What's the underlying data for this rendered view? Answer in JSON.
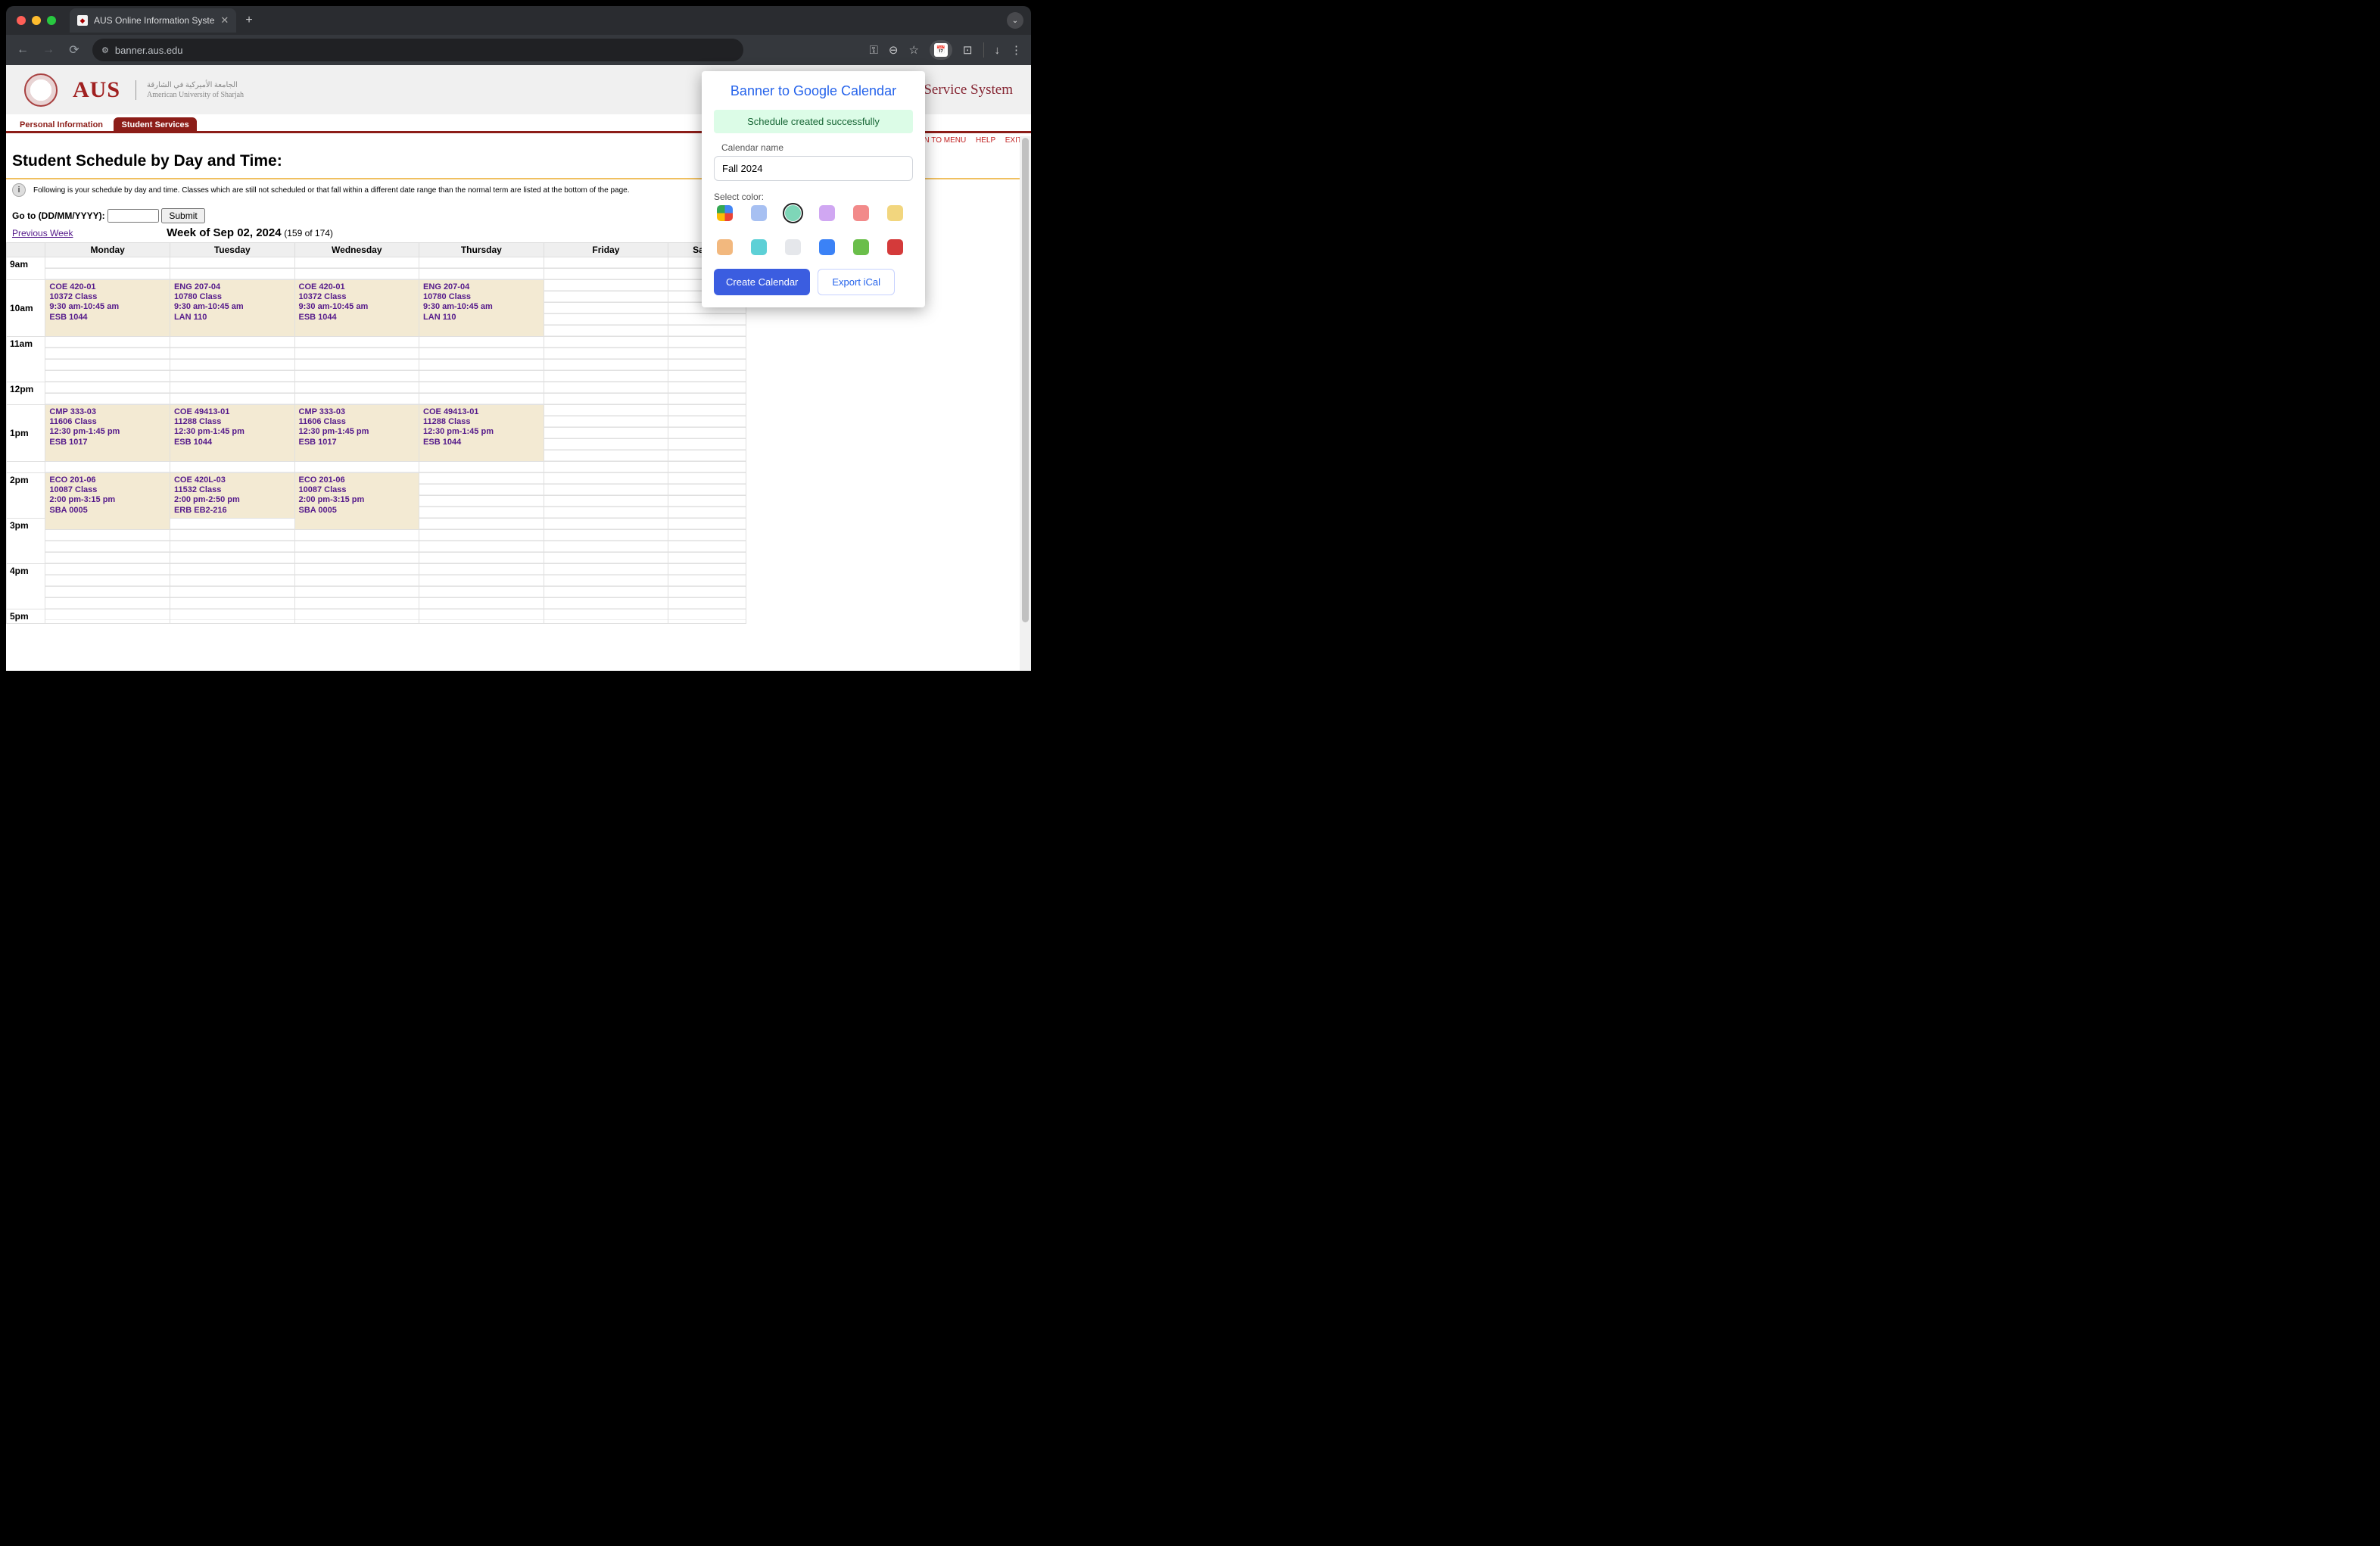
{
  "browser": {
    "tab_title": "AUS Online Information Syste",
    "url": "banner.aus.edu"
  },
  "header": {
    "logo_text": "AUS",
    "logo_arabic": "الجامعة الأميركية في الشارقة",
    "logo_sub": "American University of Sharjah",
    "service_suffix": "f-Service System"
  },
  "nav": {
    "tab1": "Personal Information",
    "tab2": "Student Services",
    "return": "RETURN TO MENU",
    "help": "HELP",
    "exit": "EXIT"
  },
  "page": {
    "title": "Student Schedule by Day and Time:",
    "help_text": "Following is your schedule by day and time. Classes which are still not scheduled or that fall within a different date range than the normal term are listed at the bottom of the page.",
    "goto_label": "Go to (DD/MM/YYYY):",
    "submit_label": "Submit",
    "prev_week": "Previous Week",
    "week_title": "Week of Sep 02, 2024",
    "week_sub": "(159 of 174)"
  },
  "days": [
    "Monday",
    "Tuesday",
    "Wednesday",
    "Thursday",
    "Friday",
    "Saturd"
  ],
  "times": [
    "9am",
    "10am",
    "11am",
    "12pm",
    "1pm",
    "2pm",
    "3pm",
    "4pm",
    "5pm"
  ],
  "events": {
    "mon_930": {
      "course": "COE 420-01",
      "crn": "10372 Class",
      "time": "9:30 am-10:45 am",
      "room": "ESB 1044"
    },
    "tue_930": {
      "course": "ENG 207-04",
      "crn": "10780 Class",
      "time": "9:30 am-10:45 am",
      "room": "LAN 110"
    },
    "wed_930": {
      "course": "COE 420-01",
      "crn": "10372 Class",
      "time": "9:30 am-10:45 am",
      "room": "ESB 1044"
    },
    "thu_930": {
      "course": "ENG 207-04",
      "crn": "10780 Class",
      "time": "9:30 am-10:45 am",
      "room": "LAN 110"
    },
    "mon_1230": {
      "course": "CMP 333-03",
      "crn": "11606 Class",
      "time": "12:30 pm-1:45 pm",
      "room": "ESB 1017"
    },
    "tue_1230": {
      "course": "COE 49413-01",
      "crn": "11288 Class",
      "time": "12:30 pm-1:45 pm",
      "room": "ESB 1044"
    },
    "wed_1230": {
      "course": "CMP 333-03",
      "crn": "11606 Class",
      "time": "12:30 pm-1:45 pm",
      "room": "ESB 1017"
    },
    "thu_1230": {
      "course": "COE 49413-01",
      "crn": "11288 Class",
      "time": "12:30 pm-1:45 pm",
      "room": "ESB 1044"
    },
    "mon_1400": {
      "course": "ECO 201-06",
      "crn": "10087 Class",
      "time": "2:00 pm-3:15 pm",
      "room": "SBA 0005"
    },
    "tue_1400": {
      "course": "COE 420L-03",
      "crn": "11532 Class",
      "time": "2:00 pm-2:50 pm",
      "room": "ERB EB2-216"
    },
    "wed_1400": {
      "course": "ECO 201-06",
      "crn": "10087 Class",
      "time": "2:00 pm-3:15 pm",
      "room": "SBA 0005"
    }
  },
  "extension": {
    "title": "Banner to Google Calendar",
    "success": "Schedule created successfully",
    "cal_label": "Calendar name",
    "cal_value": "Fall 2024",
    "color_label": "Select color:",
    "colors": [
      {
        "hex": "multi",
        "selected": false
      },
      {
        "hex": "#a7c0f2",
        "selected": false
      },
      {
        "hex": "#7ed6b8",
        "selected": true
      },
      {
        "hex": "#d0a7f2",
        "selected": false
      },
      {
        "hex": "#f28a8a",
        "selected": false
      },
      {
        "hex": "#f2d67e",
        "selected": false
      },
      {
        "hex": "#f2b87e",
        "selected": false
      },
      {
        "hex": "#5dd0d6",
        "selected": false
      },
      {
        "hex": "#e5e7eb",
        "selected": false
      },
      {
        "hex": "#3b82f6",
        "selected": false
      },
      {
        "hex": "#6abe4a",
        "selected": false
      },
      {
        "hex": "#d43a3a",
        "selected": false
      }
    ],
    "create_btn": "Create Calendar",
    "export_btn": "Export iCal"
  }
}
